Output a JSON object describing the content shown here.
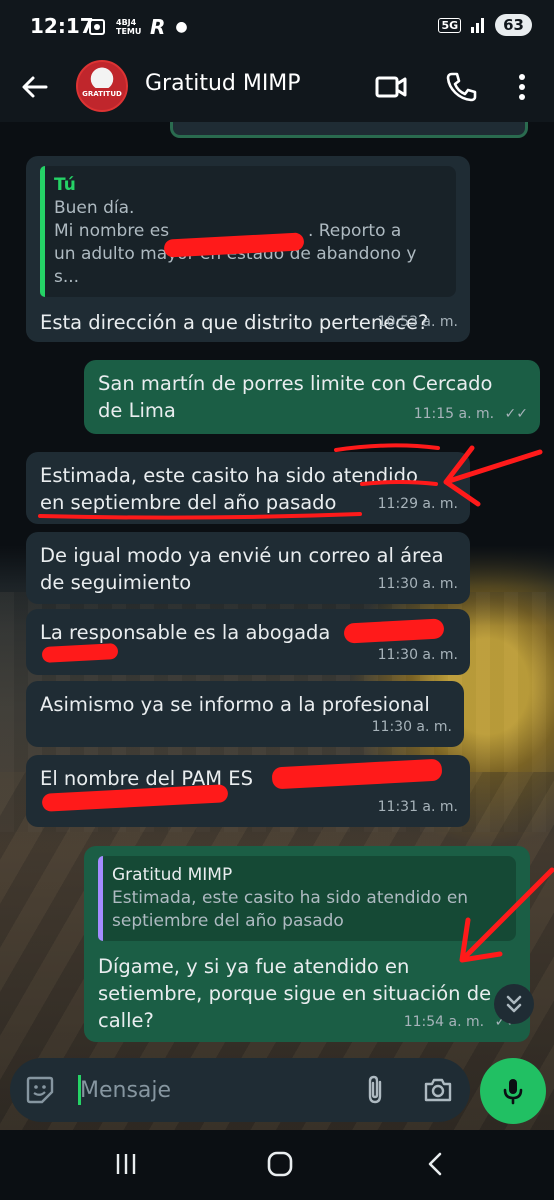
{
  "status_bar": {
    "time": "12:17",
    "temu_label": "4BJ4 TEMU",
    "network": "5G",
    "battery": "63"
  },
  "header": {
    "contact_name": "Gratitud MIMP",
    "avatar_text": "GRATITUD"
  },
  "messages": [
    {
      "direction": "incoming",
      "quote_author": "Tú",
      "quote_lines": [
        "Buen día.",
        "Mi nombre es",
        ". Reporto a",
        "un adulto mayor en estado de abandono y s..."
      ],
      "text": "Esta dirección a que distrito pertenece?",
      "time": "10:53 a. m."
    },
    {
      "direction": "outgoing",
      "text_lines": [
        "San martín de porres limite con Cercado",
        "de Lima"
      ],
      "time": "11:15 a. m."
    },
    {
      "direction": "incoming",
      "text_lines": [
        "Estimada, este casito ha sido atendido",
        "en septiembre del año pasado"
      ],
      "time": "11:29 a. m."
    },
    {
      "direction": "incoming",
      "text_lines": [
        "De igual modo ya envié un correo al área",
        "de seguimiento"
      ],
      "time": "11:30 a. m."
    },
    {
      "direction": "incoming",
      "text": "La responsable es la abogada",
      "time": "11:30 a. m."
    },
    {
      "direction": "incoming",
      "text": "Asimismo ya se informo a la profesional",
      "time": "11:30 a. m."
    },
    {
      "direction": "incoming",
      "text": "El nombre del PAM ES",
      "time": "11:31 a. m."
    },
    {
      "direction": "outgoing",
      "quote_author": "Gratitud MIMP",
      "quote_lines": [
        "Estimada, este casito ha sido atendido en",
        "septiembre del año pasado"
      ],
      "text_lines": [
        "Dígame, y si ya fue atendido en",
        "setiembre, porque sigue en situación de",
        "calle?"
      ],
      "time": "11:54 a. m."
    }
  ],
  "composer": {
    "placeholder": "Mensaje"
  },
  "colors": {
    "incoming_bubble": "#1f2c34",
    "outgoing_bubble": "#1b5e45",
    "accent": "#25d366",
    "annotation_red": "#ff1a1a"
  }
}
